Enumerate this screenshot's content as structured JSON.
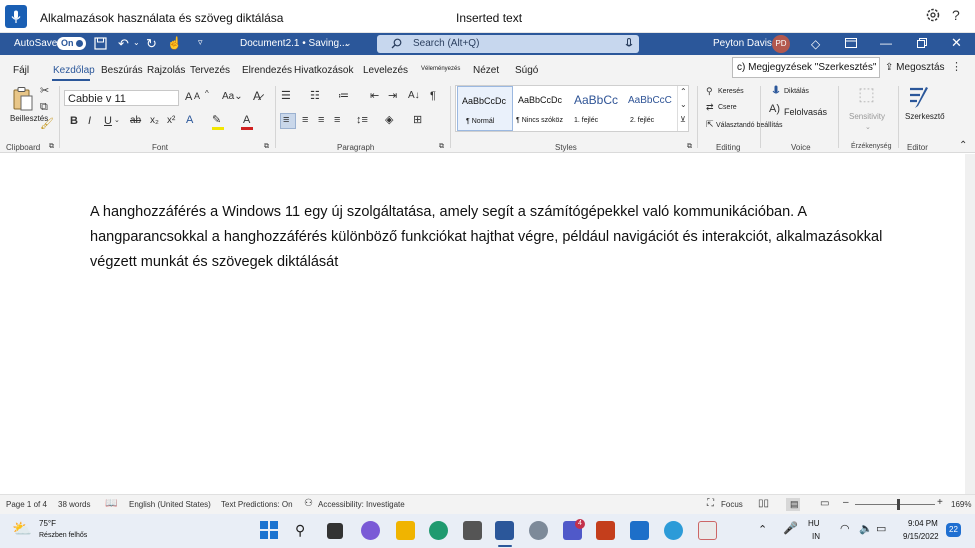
{
  "voice_bar": {
    "title": "Alkalmazások használata és szöveg diktálása",
    "status": "Inserted text"
  },
  "title_bar": {
    "autosave_label": "AutoSave",
    "autosave_state": "On",
    "doc_name": "Document2.1 • Saving... ",
    "search_placeholder": "Search (Alt+Q)",
    "user_name": "Peyton Davis",
    "user_initials": "PD"
  },
  "tabs": [
    "Fájl",
    "Kezdőlap",
    "Beszúrás",
    "Rajzolás",
    "Tervezés",
    "Elrendezés",
    "Hivatkozások",
    "Levelezés",
    "Véleményezés",
    "Nézet",
    "Súgó"
  ],
  "active_tab": "Kezdőlap",
  "comments_button": "c) Megjegyzések \"Szerkesztés\"",
  "share_button": "Megosztás",
  "ribbon": {
    "clipboard": {
      "paste": "Beillesztés",
      "label": "Clipboard"
    },
    "font": {
      "name": "Cabbie v 11",
      "size_label": "11",
      "label": "Font"
    },
    "paragraph": {
      "label": "Paragraph"
    },
    "styles": {
      "items": [
        {
          "preview": "AaBbCcDc",
          "name": "¶ Normál"
        },
        {
          "preview": "AaBbCcDc",
          "name": "¶ Nincs szóköz"
        },
        {
          "preview": "AaBbCc",
          "name": "1. fejléc"
        },
        {
          "preview": "AaBbCcC",
          "name": "2. fejléc"
        }
      ],
      "label": "Styles"
    },
    "editing": {
      "find": "Keresés",
      "replace": "Csere",
      "select": "Választandó beállítás",
      "label": "Editing"
    },
    "voice": {
      "dictate": "Diktálás",
      "read_aloud": "Felolvasás",
      "label": "Voice"
    },
    "sensitivity": {
      "button": "Sensitivity",
      "label": "Érzékenység"
    },
    "editor": {
      "button": "Szerkesztő",
      "label": "Editor"
    }
  },
  "document": {
    "text": "A hanghozzáférés a Windows 11 egy új szolgáltatása, amely segít a számítógépekkel való kommunikációban. A hangparancsokkal a hanghozzáférés különböző funkciókat hajthat végre, például navigációt és interakciót, alkalmazásokkal végzett munkát és szövegek diktálását"
  },
  "status_bar": {
    "page": "Page 1 of 4",
    "words": "38 words",
    "language": "English (United States)",
    "text_predictions": "Text Predictions: On",
    "accessibility": "Accessibility: Investigate",
    "focus": "Focus",
    "zoom": "169%"
  },
  "taskbar": {
    "weather_temp": "75°F",
    "weather_desc": "Részben felhős",
    "teams_badge": "4",
    "lang_top": "HU",
    "lang_bottom": "IN",
    "time": "9:04 PM",
    "date": "9/15/2022",
    "notifications": "22"
  },
  "colors": {
    "word_blue": "#2b579a",
    "ribbon_bg": "#f3f3f3",
    "taskbar_bg": "#e9eef6"
  }
}
